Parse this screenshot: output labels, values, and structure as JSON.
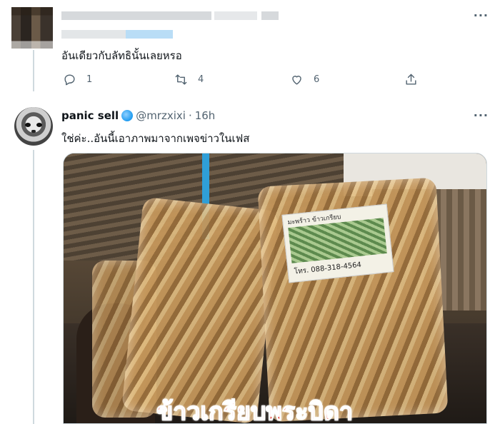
{
  "tweet1": {
    "text": "อันเดียวกับลัทธินั้นเลยหรอ",
    "more_label": "···",
    "actions": {
      "reply_count": "1",
      "retweet_count": "4",
      "like_count": "6"
    }
  },
  "tweet2": {
    "display_name": "panic sell",
    "handle": "@mrzxixi",
    "separator": "·",
    "time": "16h",
    "more_label": "···",
    "text": "ใช่ค่ะ..อันนี้เอาภาพมาจากเพจข่าวในเฟส",
    "media": {
      "label_top": "มะพร้าว ข้าวเกรียบ",
      "label_phone": "โทร. 088-318-4564",
      "caption": "ข้าวเกรียบพระบิดา"
    }
  },
  "colors": {
    "text_primary": "#0f1419",
    "text_secondary": "#536471",
    "caption_red": "#e4322b"
  },
  "icons": [
    "more-icon",
    "reply-icon",
    "retweet-icon",
    "like-icon",
    "share-icon",
    "verified-globe-icon"
  ]
}
